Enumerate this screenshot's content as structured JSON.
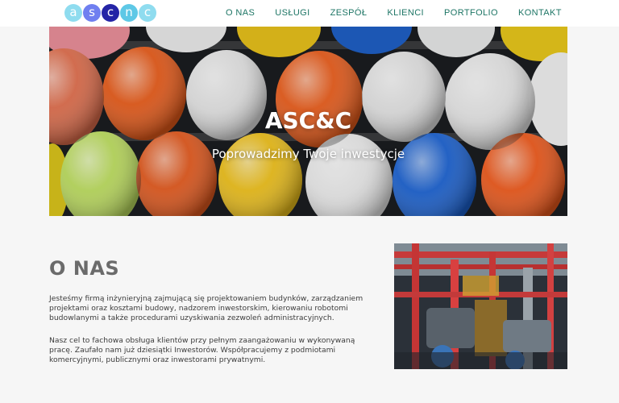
{
  "logo": {
    "letters": [
      "a",
      "s",
      "c",
      "n",
      "c"
    ],
    "colors": [
      "#8fdcef",
      "#6f7ff0",
      "#2424a6",
      "#5ec8e6",
      "#8fdcef"
    ]
  },
  "nav": {
    "items": [
      "O NAS",
      "USŁUGI",
      "ZESPÓŁ",
      "KLIENCI",
      "PORTFOLIO",
      "KONTAKT"
    ],
    "color": "#1d7565"
  },
  "hero": {
    "title": "ASC&C",
    "subtitle": "Poprowadzimy Twoje inwestycje"
  },
  "about": {
    "title": "O NAS",
    "paragraph1": "Jesteśmy firmą inżynieryjną zajmującą się projektowaniem budynków, zarządzaniem projektami oraz kosztami budowy, nadzorem inwestorskim, kierowaniu robotomi budowlanymi a także procedurami uzyskiwania zezwoleń administracyjnych.",
    "paragraph2": "Nasz cel to fachowa obsługa klientów przy pełnym zaangażowaniu w wykonywaną pracę. Zaufało nam już dziesiątki Inwestorów. Współpracujemy z podmiotami komercyjnymi, publicznymi oraz inwestorami prywatnymi."
  },
  "colors": {
    "page_bg": "#f6f6f6",
    "heading": "#6b6b6b",
    "text": "#3c3c3c"
  }
}
